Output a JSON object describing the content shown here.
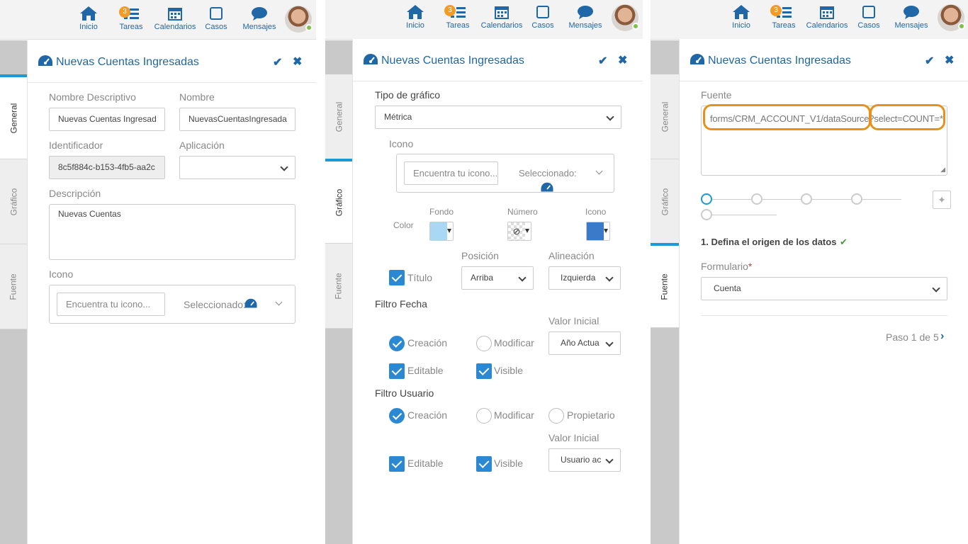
{
  "topnav": {
    "inicio": "Inicio",
    "tareas": "Tareas",
    "tareas_badge": "3",
    "calendarios": "Calendarios",
    "casos": "Casos",
    "mensajes": "Mensajes"
  },
  "tabs": {
    "general": "General",
    "grafico": "Gráfico",
    "fuente": "Fuente"
  },
  "dialog_title": "Nuevas Cuentas Ingresadas",
  "general": {
    "nombre_descriptivo_label": "Nombre Descriptivo",
    "nombre_descriptivo_value": "Nuevas Cuentas Ingresad",
    "nombre_label": "Nombre",
    "nombre_value": "NuevasCuentasIngresada",
    "identificador_label": "Identificador",
    "identificador_value": "8c5f884c-b153-4fb5-aa2c",
    "aplicacion_label": "Aplicación",
    "aplicacion_value": "",
    "descripcion_label": "Descripción",
    "descripcion_value": "Nuevas Cuentas",
    "icono_label": "Icono",
    "icono_placeholder": "Encuentra tu icono...",
    "seleccionado_label": "Seleccionado:"
  },
  "grafico": {
    "tipo_label": "Tipo de gráfico",
    "tipo_value": "Métrica",
    "icono_label": "Icono",
    "icono_placeholder": "Encuentra tu icono...",
    "seleccionado_label": "Seleccionado:",
    "color_label": "Color",
    "fondo_label": "Fondo",
    "numero_label": "Número",
    "icono_color_label": "Icono",
    "fondo_color": "#a8d8f3",
    "icono_color": "#3a7ac9",
    "posicion_label": "Posición",
    "posicion_value": "Arriba",
    "alineacion_label": "Alineación",
    "alineacion_value": "Izquierda",
    "titulo_label": "Título",
    "filtro_fecha_label": "Filtro Fecha",
    "valor_inicial_label": "Valor Inicial",
    "fecha_valor_inicial": "Año Actua",
    "creacion_label": "Creación",
    "modificar_label": "Modificar",
    "editable_label": "Editable",
    "visible_label": "Visible",
    "filtro_usuario_label": "Filtro Usuario",
    "propietario_label": "Propietario",
    "usuario_valor_inicial": "Usuario ac"
  },
  "fuente": {
    "fuente_label": "Fuente",
    "fuente_part1": "forms/CRM_ACCOUNT_V1/dataSource",
    "fuente_sep": "?",
    "fuente_part2": "select=COUNT=*",
    "step_title": "1. Defina el origen de los datos",
    "formulario_label": "Formulario",
    "required_mark": "*",
    "formulario_value": "Cuenta",
    "paso_label": "Paso 1 de 5"
  },
  "colors": {
    "accent": "#1f67a6",
    "check": "#2b88d2",
    "highlight": "#e8901c",
    "badge": "#f39a27"
  }
}
